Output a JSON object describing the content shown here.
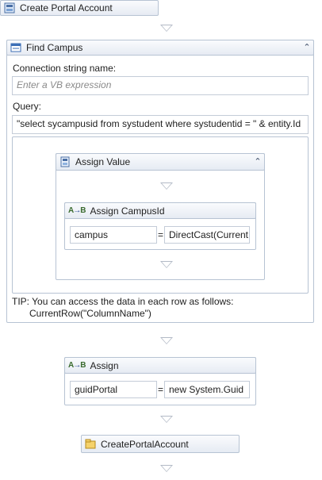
{
  "sequence": {
    "title": "Create Portal Account"
  },
  "find_campus": {
    "title": "Find Campus",
    "connection_label": "Connection string name:",
    "connection_placeholder": "Enter a VB expression",
    "query_label": "Query:",
    "query_value": "\"select sycampusid from systudent where systudentid = \" & entity.Id",
    "tip_line1": "TIP: You can access the data in each row as follows:",
    "tip_line2": "CurrentRow(\"ColumnName\")"
  },
  "assign_value": {
    "title": "Assign Value"
  },
  "assign_campus": {
    "title": "Assign CampusId",
    "to": "campus",
    "equals": "=",
    "value": "DirectCast(Current"
  },
  "assign_guid": {
    "title": "Assign",
    "to": "guidPortal",
    "equals": "=",
    "value": "new System.Guid"
  },
  "create_portal": {
    "title": "CreatePortalAccount"
  },
  "icons": {
    "sequence": "workflow-sequence-icon",
    "find_campus": "database-query-icon",
    "assign_value": "assign-value-icon",
    "assign": "ab-assign-icon",
    "create_portal": "custom-activity-icon",
    "collapse": "double-chevron-up-icon"
  },
  "colors": {
    "border": "#b7c3d3",
    "header_gradient_top": "#fafbfd",
    "header_gradient_bottom": "#e6ebf3"
  }
}
